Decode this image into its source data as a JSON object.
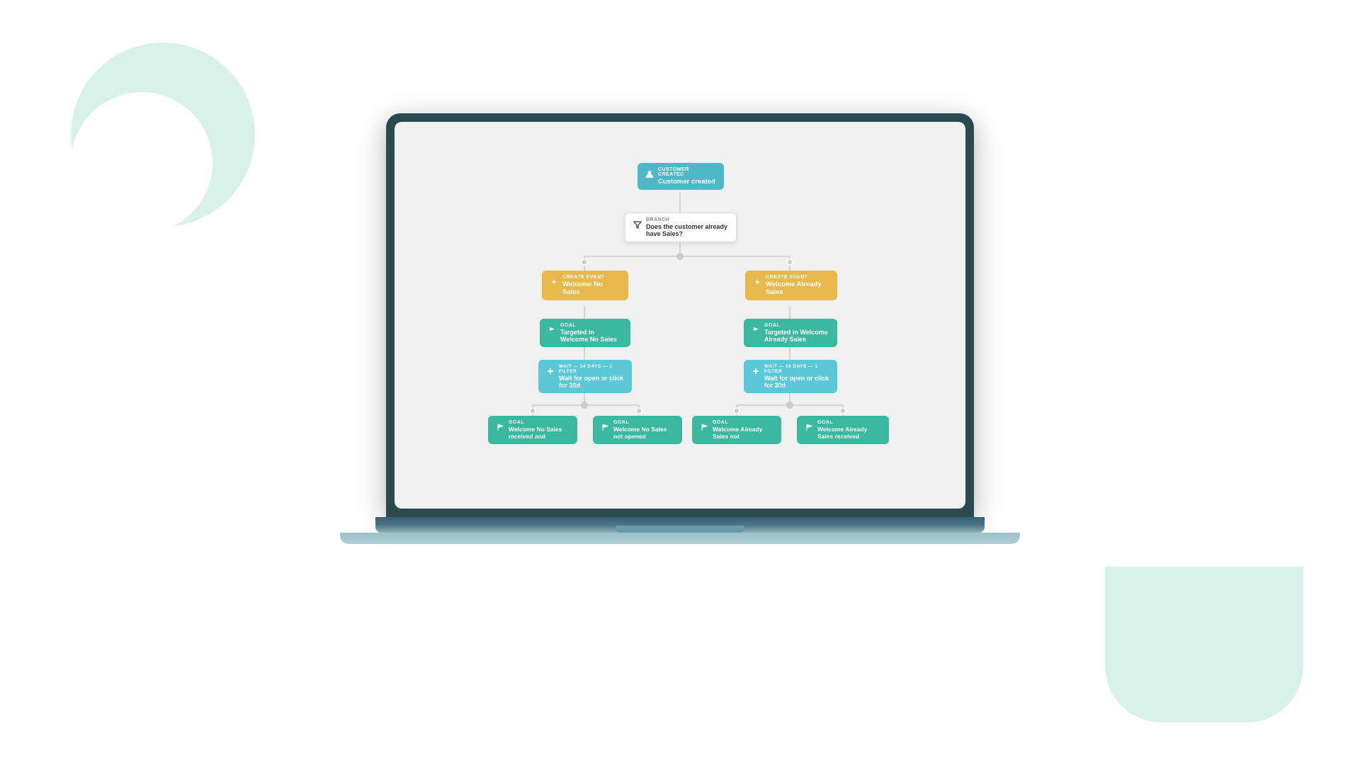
{
  "background": {
    "color": "#ffffff"
  },
  "laptop": {
    "screen_bg": "#f0f0f0",
    "body_color": "#2a4a52"
  },
  "flowchart": {
    "nodes": {
      "customer_created": {
        "label": "CUSTOMER CREATED",
        "title": "Customer created",
        "type": "blue",
        "icon": "person-icon"
      },
      "branch": {
        "label": "BRANCH",
        "title": "Does the customer already have Sales?",
        "type": "white",
        "icon": "filter-icon"
      },
      "create_event_no_sales": {
        "label": "CREATE EVENT",
        "title": "Welcome No Sales",
        "type": "yellow",
        "icon": "lightning-icon"
      },
      "create_event_already_sales": {
        "label": "CREATE EVENT",
        "title": "Welcome Already Sales",
        "type": "yellow",
        "icon": "lightning-icon"
      },
      "goal_no_sales": {
        "label": "GOAL",
        "title": "Targeted in Welcome No Sales",
        "type": "teal",
        "icon": "flag-icon"
      },
      "goal_already_sales": {
        "label": "GOAL",
        "title": "Targeted in Welcome Already Sales",
        "type": "teal",
        "icon": "flag-icon"
      },
      "wait_no_sales": {
        "label": "WAIT — 14 DAYS — 1 FILTER",
        "title": "Wait for open or click for 30d",
        "type": "cyan",
        "icon": "plus-icon"
      },
      "wait_already_sales": {
        "label": "WAIT — 14 DAYS — 1 FILTER",
        "title": "Wait for open or click for 30d",
        "type": "cyan",
        "icon": "plus-icon"
      },
      "goal_no_sales_received": {
        "label": "GOAL",
        "title": "Welcome No Sales received and",
        "type": "teal",
        "icon": "flag-icon"
      },
      "goal_no_sales_not_opened": {
        "label": "GOAL",
        "title": "Welcome No Sales not opened",
        "type": "teal",
        "icon": "flag-icon"
      },
      "goal_already_sales_not": {
        "label": "GOAL",
        "title": "Welcome Already Sales not",
        "type": "teal",
        "icon": "flag-icon"
      },
      "goal_already_sales_received": {
        "label": "GOAL",
        "title": "Welcome Already Sales received",
        "type": "teal",
        "icon": "flag-icon"
      }
    }
  }
}
